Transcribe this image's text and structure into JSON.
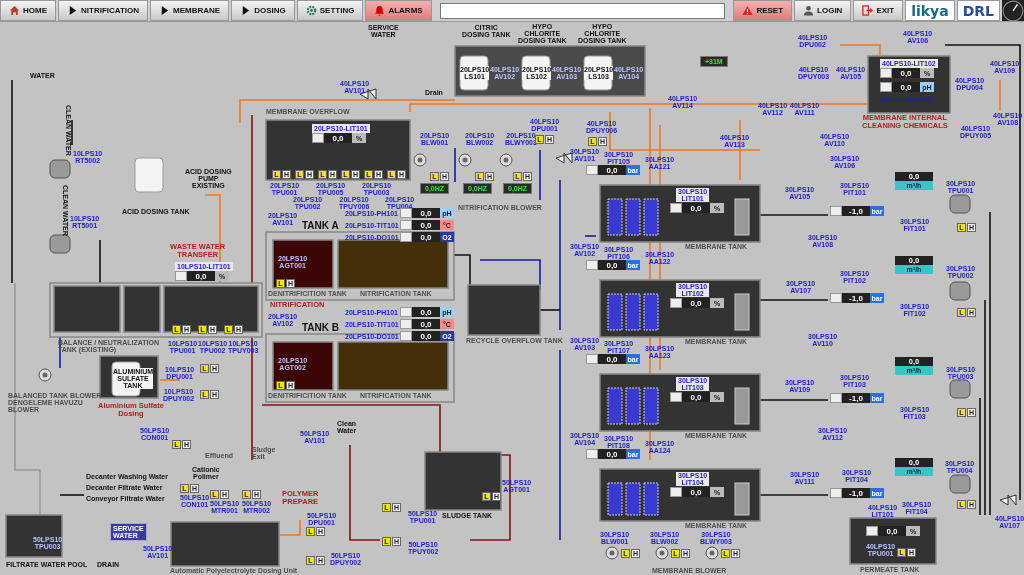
{
  "toolbar": {
    "buttons": [
      {
        "label": "HOME",
        "kind": "home"
      },
      {
        "label": "NITRIFICATION",
        "kind": "nav"
      },
      {
        "label": "MEMBRANE",
        "kind": "nav"
      },
      {
        "label": "DOSING",
        "kind": "nav"
      },
      {
        "label": "SETTING",
        "kind": "setting"
      },
      {
        "label": "ALARMS",
        "kind": "alarm"
      }
    ],
    "actions": [
      {
        "label": "RESET",
        "kind": "reset"
      },
      {
        "label": "LOGIN",
        "kind": "login"
      },
      {
        "label": "EXIT",
        "kind": "exit"
      }
    ],
    "logos": [
      "likya",
      "DRL"
    ]
  },
  "diagram": {
    "labels": [
      {
        "lines": [
          "SERVICE",
          "WATER"
        ],
        "kind": "black"
      },
      {
        "lines": [
          "40LPS10",
          "AV101"
        ],
        "kind": "tag"
      },
      {
        "lines": [
          "Drain"
        ],
        "kind": "black"
      },
      {
        "lines": [
          "CITRIC",
          "DOSING TANK"
        ],
        "kind": "black"
      },
      {
        "lines": [
          "HYPO",
          "CHLORITE",
          "DOSING TANK"
        ],
        "kind": "black"
      },
      {
        "lines": [
          "HYPO",
          "CHLORITE",
          "DOSING TANK"
        ],
        "kind": "black"
      },
      {
        "lines": [
          "20LPS10",
          "LS101"
        ],
        "kind": "tank"
      },
      {
        "lines": [
          "40LPS10",
          "AV102"
        ],
        "kind": "darktag"
      },
      {
        "lines": [
          "20LPS10",
          "LS102"
        ],
        "kind": "tank"
      },
      {
        "lines": [
          "40LPS10",
          "AV103"
        ],
        "kind": "darktag"
      },
      {
        "lines": [
          "20LPS10",
          "LS103"
        ],
        "kind": "tank"
      },
      {
        "lines": [
          "40LPS10",
          "AV104"
        ],
        "kind": "darktag"
      },
      {
        "lines": [
          "40LPS10",
          "DPU002"
        ],
        "kind": "tag"
      },
      {
        "lines": [
          "40LPS10",
          "DPUY003"
        ],
        "kind": "tag"
      },
      {
        "lines": [
          "40LPS10",
          "AV105"
        ],
        "kind": "tag"
      },
      {
        "lines": [
          "40LPS10",
          "AV106"
        ],
        "kind": "tag"
      },
      {
        "lines": [
          "MEMBRANE INTERNAL",
          "CLEANING CHEMICALS"
        ],
        "kind": "red"
      },
      {
        "lines": [
          "40LPS10",
          "DPU004"
        ],
        "kind": "tag"
      },
      {
        "lines": [
          "40LPS10",
          "AV109"
        ],
        "kind": "tag"
      },
      {
        "lines": [
          "40LPS10",
          "DPUY005"
        ],
        "kind": "tag"
      },
      {
        "lines": [
          "40LPS10",
          "AV108"
        ],
        "kind": "tag"
      },
      {
        "lines": [
          "40LPS10",
          "AV114"
        ],
        "kind": "tag"
      },
      {
        "lines": [
          "40LPS10",
          "DPU001"
        ],
        "kind": "tag"
      },
      {
        "lines": [
          "40LPS10",
          "DPUY006"
        ],
        "kind": "tag"
      },
      {
        "lines": [
          "30LPS10",
          "AV101"
        ],
        "kind": "tag"
      },
      {
        "lines": [
          "40LPS10",
          "AV112"
        ],
        "kind": "tag"
      },
      {
        "lines": [
          "40LPS10",
          "AV111"
        ],
        "kind": "tag"
      },
      {
        "lines": [
          "40LPS10",
          "AV113"
        ],
        "kind": "tag"
      },
      {
        "lines": [
          "40LPS10",
          "AV110"
        ],
        "kind": "tag"
      },
      {
        "lines": [
          "MEMBRANE OVERFLOW"
        ],
        "kind": "title"
      },
      {
        "lines": [
          "20LPS10",
          "TPU001"
        ],
        "kind": "tag"
      },
      {
        "lines": [
          "20LPS10",
          "TPU002"
        ],
        "kind": "tag"
      },
      {
        "lines": [
          "20LPS10",
          "TPU005"
        ],
        "kind": "tag"
      },
      {
        "lines": [
          "20LPS10",
          "TPUY006"
        ],
        "kind": "tag"
      },
      {
        "lines": [
          "20LPS10",
          "TPU003"
        ],
        "kind": "tag"
      },
      {
        "lines": [
          "20LPS10",
          "TPU004"
        ],
        "kind": "tag"
      },
      {
        "lines": [
          "20LPS10",
          "BLW001"
        ],
        "kind": "tag"
      },
      {
        "lines": [
          "20LPS10",
          "BLW002"
        ],
        "kind": "tag"
      },
      {
        "lines": [
          "20LPS10",
          "BLWY003"
        ],
        "kind": "tag"
      },
      {
        "lines": [
          "NITRIFICATION BLOWER"
        ],
        "kind": "title"
      },
      {
        "lines": [
          "20LPS10",
          "AV101"
        ],
        "kind": "tag"
      },
      {
        "lines": [
          "TANK A"
        ],
        "kind": "big"
      },
      {
        "lines": [
          "20LPS10",
          "AGT001"
        ],
        "kind": "darktag"
      },
      {
        "lines": [
          "DENITRIFICITION TANK"
        ],
        "kind": "title"
      },
      {
        "lines": [
          "NITRIFICATION TANK"
        ],
        "kind": "title"
      },
      {
        "lines": [
          "NITRIFICATION"
        ],
        "kind": "red"
      },
      {
        "lines": [
          "20LPS10",
          "AV102"
        ],
        "kind": "tag"
      },
      {
        "lines": [
          "TANK B"
        ],
        "kind": "big"
      },
      {
        "lines": [
          "20LPS10",
          "AGT002"
        ],
        "kind": "darktag"
      },
      {
        "lines": [
          "DENITRIFICITION TANK"
        ],
        "kind": "title"
      },
      {
        "lines": [
          "NITRIFICATION TANK"
        ],
        "kind": "title"
      },
      {
        "lines": [
          "RECYCLE OVERFLOW TANK"
        ],
        "kind": "title"
      },
      {
        "lines": [
          "WATER"
        ],
        "kind": "black"
      },
      {
        "lines": [
          "CLEAN WATER"
        ],
        "kind": "vertical"
      },
      {
        "lines": [
          "10LPS10",
          "RT5002"
        ],
        "kind": "tag"
      },
      {
        "lines": [
          "CLEAN WATER"
        ],
        "kind": "vertical"
      },
      {
        "lines": [
          "10LPS10",
          "RT5001"
        ],
        "kind": "tag"
      },
      {
        "lines": [
          "ACID DOSING TANK"
        ],
        "kind": "black"
      },
      {
        "lines": [
          "ACID DOSING",
          "PUMP",
          "EXISTING"
        ],
        "kind": "black"
      },
      {
        "lines": [
          "WASTE WATER",
          "TRANSFER"
        ],
        "kind": "red"
      },
      {
        "lines": [
          "BALANCE / NEUTRALIZATION",
          "TANK (EXISTING)"
        ],
        "kind": "title"
      },
      {
        "lines": [
          "10LPS10",
          "TPU001"
        ],
        "kind": "tag"
      },
      {
        "lines": [
          "10LPS10",
          "TPU002"
        ],
        "kind": "tag"
      },
      {
        "lines": [
          "10LPS10",
          "TPUY003"
        ],
        "kind": "tag"
      },
      {
        "lines": [
          "BALANCED TANK BLOWER",
          "DENGELEME HAVUZU",
          "BLOWER"
        ],
        "kind": "title"
      },
      {
        "lines": [
          "ALUMINIUM",
          "SULFATE",
          "TANK"
        ],
        "kind": "tank"
      },
      {
        "lines": [
          "10LPS10",
          "DPU001"
        ],
        "kind": "tag"
      },
      {
        "lines": [
          "10LPS10",
          "DPUY002"
        ],
        "kind": "tag"
      },
      {
        "lines": [
          "Aluminium Sulfate",
          "Dosing"
        ],
        "kind": "red"
      },
      {
        "lines": [
          "50LPS10",
          "CON001"
        ],
        "kind": "tag"
      },
      {
        "lines": [
          "Effluend"
        ],
        "kind": "title"
      },
      {
        "lines": [
          "Sludge",
          "Exit"
        ],
        "kind": "title"
      },
      {
        "lines": [
          "50LPS10",
          "AV101"
        ],
        "kind": "tag"
      },
      {
        "lines": [
          "Clean",
          "Water"
        ],
        "kind": "black"
      },
      {
        "lines": [
          "Decanter Washing Water"
        ],
        "kind": "black"
      },
      {
        "lines": [
          "Decanter Filtrate Water"
        ],
        "kind": "black"
      },
      {
        "lines": [
          "Conveyor Filtrate Water"
        ],
        "kind": "black"
      },
      {
        "lines": [
          "Cationic",
          "Polimer"
        ],
        "kind": "black"
      },
      {
        "lines": [
          "50LPS10",
          "CON101"
        ],
        "kind": "tag"
      },
      {
        "lines": [
          "50LPS10",
          "MTR001"
        ],
        "kind": "tag"
      },
      {
        "lines": [
          "50LPS10",
          "MTR002"
        ],
        "kind": "tag"
      },
      {
        "lines": [
          "SERVICE",
          "WATER"
        ],
        "kind": "badge"
      },
      {
        "lines": [
          "50LPS10",
          "AV101"
        ],
        "kind": "tag"
      },
      {
        "lines": [
          "50LPS10",
          "TPU003"
        ],
        "kind": "darktag"
      },
      {
        "lines": [
          "FILTRATE WATER POOL"
        ],
        "kind": "black"
      },
      {
        "lines": [
          "DRAIN"
        ],
        "kind": "black"
      },
      {
        "lines": [
          "Automatic Polyelectrolyte Dosing Unit"
        ],
        "kind": "title"
      },
      {
        "lines": [
          "POLYMER",
          "PREPARE"
        ],
        "kind": "red"
      },
      {
        "lines": [
          "50LPS10",
          "DPU001"
        ],
        "kind": "tag"
      },
      {
        "lines": [
          "50LPS10",
          "DPUY002"
        ],
        "kind": "tag"
      },
      {
        "lines": [
          "SLUDGE TANK"
        ],
        "kind": "black"
      },
      {
        "lines": [
          "50LPS10",
          "AGT001"
        ],
        "kind": "tag"
      },
      {
        "lines": [
          "50LPS10",
          "TPU001"
        ],
        "kind": "tag"
      },
      {
        "lines": [
          "50LPS10",
          "TPUY002"
        ],
        "kind": "tag"
      },
      {
        "lines": [
          "30LPS10",
          "AV102"
        ],
        "kind": "tag"
      },
      {
        "lines": [
          "30LPS10",
          "AV103"
        ],
        "kind": "tag"
      },
      {
        "lines": [
          "30LPS10",
          "AV104"
        ],
        "kind": "tag"
      },
      {
        "lines": [
          "30LPS10",
          "PIT105"
        ],
        "kind": "tag"
      },
      {
        "lines": [
          "30LPS10",
          "PIT106"
        ],
        "kind": "tag"
      },
      {
        "lines": [
          "30LPS10",
          "PIT107"
        ],
        "kind": "tag"
      },
      {
        "lines": [
          "30LPS10",
          "PIT108"
        ],
        "kind": "tag"
      },
      {
        "lines": [
          "30LPS10",
          "AA121"
        ],
        "kind": "tag"
      },
      {
        "lines": [
          "30LPS10",
          "AA122"
        ],
        "kind": "tag"
      },
      {
        "lines": [
          "30LPS10",
          "AA123"
        ],
        "kind": "tag"
      },
      {
        "lines": [
          "30LPS10",
          "AA124"
        ],
        "kind": "tag"
      },
      {
        "lines": [
          "30LPS10",
          "LIT101"
        ],
        "kind": "boxtag"
      },
      {
        "lines": [
          "MEMBRANE TANK"
        ],
        "kind": "title"
      },
      {
        "lines": [
          "30LPS10",
          "LIT102"
        ],
        "kind": "boxtag"
      },
      {
        "lines": [
          "MEMBRANE TANK"
        ],
        "kind": "title"
      },
      {
        "lines": [
          "30LPS10",
          "LIT103"
        ],
        "kind": "boxtag"
      },
      {
        "lines": [
          "MEMBRANE TANK"
        ],
        "kind": "title"
      },
      {
        "lines": [
          "30LPS10",
          "LIT104"
        ],
        "kind": "boxtag"
      },
      {
        "lines": [
          "MEMBRANE TANK"
        ],
        "kind": "title"
      },
      {
        "lines": [
          "30LPS10",
          "AV106"
        ],
        "kind": "tag"
      },
      {
        "lines": [
          "30LPS10",
          "AV105"
        ],
        "kind": "tag"
      },
      {
        "lines": [
          "30LPS10",
          "PIT101"
        ],
        "kind": "tag"
      },
      {
        "lines": [
          "30LPS10",
          "FIT101"
        ],
        "kind": "tag"
      },
      {
        "lines": [
          "30LPS10",
          "TPU001"
        ],
        "kind": "tag"
      },
      {
        "lines": [
          "30LPS10",
          "AV108"
        ],
        "kind": "tag"
      },
      {
        "lines": [
          "30LPS10",
          "AV107"
        ],
        "kind": "tag"
      },
      {
        "lines": [
          "30LPS10",
          "PIT102"
        ],
        "kind": "tag"
      },
      {
        "lines": [
          "30LPS10",
          "FIT102"
        ],
        "kind": "tag"
      },
      {
        "lines": [
          "30LPS10",
          "TPU002"
        ],
        "kind": "tag"
      },
      {
        "lines": [
          "30LPS10",
          "AV110"
        ],
        "kind": "tag"
      },
      {
        "lines": [
          "30LPS10",
          "AV109"
        ],
        "kind": "tag"
      },
      {
        "lines": [
          "30LPS10",
          "PIT103"
        ],
        "kind": "tag"
      },
      {
        "lines": [
          "30LPS10",
          "FIT103"
        ],
        "kind": "tag"
      },
      {
        "lines": [
          "30LPS10",
          "TPU003"
        ],
        "kind": "tag"
      },
      {
        "lines": [
          "30LPS10",
          "AV112"
        ],
        "kind": "tag"
      },
      {
        "lines": [
          "30LPS10",
          "AV111"
        ],
        "kind": "tag"
      },
      {
        "lines": [
          "30LPS10",
          "PIT104"
        ],
        "kind": "tag"
      },
      {
        "lines": [
          "30LPS10",
          "FIT104"
        ],
        "kind": "tag"
      },
      {
        "lines": [
          "30LPS10",
          "TPU004"
        ],
        "kind": "tag"
      },
      {
        "lines": [
          "MEMBRANE BLOWER"
        ],
        "kind": "title"
      },
      {
        "lines": [
          "30LPS10",
          "BLW001"
        ],
        "kind": "tag"
      },
      {
        "lines": [
          "30LPS10",
          "BLW002"
        ],
        "kind": "tag"
      },
      {
        "lines": [
          "30LPS10",
          "BLWY003"
        ],
        "kind": "tag"
      },
      {
        "lines": [
          "40LPS10",
          "LIT101"
        ],
        "kind": "tag"
      },
      {
        "lines": [
          "40LPS10",
          "TPU001"
        ],
        "kind": "darktag"
      },
      {
        "lines": [
          "PERMEATE TANK"
        ],
        "kind": "title"
      },
      {
        "lines": [
          "40LPS10",
          "AV107"
        ],
        "kind": "tag"
      },
      {
        "lines": [
          "40LPS10-PH101"
        ],
        "kind": "tag"
      },
      {
        "lines": [
          "20LPS10-PH101"
        ],
        "kind": "tag"
      },
      {
        "lines": [
          "20LPS10-TIT101"
        ],
        "kind": "tag"
      },
      {
        "lines": [
          "20LPS10-DO101"
        ],
        "kind": "tag"
      },
      {
        "lines": [
          "20LPS10-PH101"
        ],
        "kind": "tag"
      },
      {
        "lines": [
          "20LPS10-TIT101"
        ],
        "kind": "tag"
      },
      {
        "lines": [
          "20LPS10-DO101"
        ],
        "kind": "tag"
      }
    ],
    "readouts": [
      {
        "tag": "40LPS10-LIT102",
        "value": "0,0",
        "unit": "%",
        "kind": "pct"
      },
      {
        "value": "0,0",
        "unit": "pH",
        "kind": "ph"
      },
      {
        "tag": "20LPS10-LIT101",
        "value": "0,0",
        "unit": "%",
        "kind": "pct"
      },
      {
        "value": "0,0",
        "unit": "pH",
        "kind": "ph"
      },
      {
        "value": "0,0",
        "unit": "°C",
        "kind": "temp"
      },
      {
        "value": "0,0",
        "unit": "O2",
        "kind": "o2"
      },
      {
        "value": "0,0",
        "unit": "pH",
        "kind": "ph"
      },
      {
        "value": "0,0",
        "unit": "°C",
        "kind": "temp"
      },
      {
        "value": "0,0",
        "unit": "O2",
        "kind": "o2"
      },
      {
        "tag": "10LPS10-LIT101",
        "value": "0,0",
        "unit": "%",
        "kind": "pct"
      },
      {
        "value": "0,0",
        "unit": "%",
        "kind": "pct"
      },
      {
        "value": "0,0",
        "unit": "%",
        "kind": "pct"
      },
      {
        "value": "0,0",
        "unit": "%",
        "kind": "pct"
      },
      {
        "value": "0,0",
        "unit": "%",
        "kind": "pct"
      },
      {
        "value": "0,0",
        "unit": "bar",
        "kind": "bar"
      },
      {
        "value": "0,0",
        "unit": "bar",
        "kind": "bar"
      },
      {
        "value": "0,0",
        "unit": "bar",
        "kind": "bar"
      },
      {
        "value": "0,0",
        "unit": "bar",
        "kind": "bar"
      },
      {
        "value": "-1,0",
        "unit": "bar",
        "kind": "bar"
      },
      {
        "value": "-1,0",
        "unit": "bar",
        "kind": "bar"
      },
      {
        "value": "-1,0",
        "unit": "bar",
        "kind": "bar"
      },
      {
        "value": "-1,0",
        "unit": "bar",
        "kind": "bar"
      },
      {
        "value": "0,0",
        "unit": "m³/h",
        "kind": "flow"
      },
      {
        "value": "0,0",
        "unit": "m³/h",
        "kind": "flow"
      },
      {
        "value": "0,0",
        "unit": "m³/h",
        "kind": "flow"
      },
      {
        "value": "0,0",
        "unit": "m³/h",
        "kind": "flow"
      },
      {
        "value": "0,0",
        "unit": "%",
        "kind": "pct"
      },
      {
        "value": "0,0HZ",
        "kind": "display"
      },
      {
        "value": "0,0HZ",
        "kind": "display"
      },
      {
        "value": "0,0HZ",
        "kind": "display"
      },
      {
        "value": "+31M",
        "kind": "display"
      }
    ],
    "indicators": [
      {
        "low": "L",
        "high": "H",
        "low_on": true
      },
      {
        "low": "L",
        "high": "H",
        "low_on": true
      },
      {
        "low": "L",
        "high": "H",
        "low_on": true
      },
      {
        "low": "L",
        "high": "H",
        "low_on": true
      },
      {
        "low": "L",
        "high": "H",
        "low_on": true
      },
      {
        "low": "L",
        "high": "H",
        "low_on": true
      },
      {
        "low": "L",
        "high": "H",
        "low_on": true
      },
      {
        "low": "L",
        "high": "H",
        "low_on": true
      },
      {
        "low": "L",
        "high": "H",
        "low_on": true
      },
      {
        "low": "L",
        "high": "H",
        "low_on": true
      },
      {
        "low": "L",
        "high": "H",
        "low_on": true
      },
      {
        "low": "L",
        "high": "H",
        "low_on": true
      },
      {
        "low": "L",
        "high": "H",
        "low_on": true
      },
      {
        "low": "L",
        "high": "H",
        "low_on": true
      },
      {
        "low": "L",
        "high": "H",
        "low_on": true
      },
      {
        "low": "L",
        "high": "H",
        "low_on": true
      },
      {
        "low": "L",
        "high": "H",
        "low_on": true
      },
      {
        "low": "L",
        "high": "H",
        "low_on": true
      },
      {
        "low": "L",
        "high": "H",
        "low_on": true
      },
      {
        "low": "L",
        "high": "H",
        "low_on": true
      },
      {
        "low": "L",
        "high": "H",
        "low_on": true
      },
      {
        "low": "L",
        "high": "H",
        "low_on": true
      },
      {
        "low": "L",
        "high": "H",
        "low_on": true
      },
      {
        "low": "L",
        "high": "H",
        "low_on": true
      },
      {
        "low": "L",
        "high": "H",
        "low_on": true
      },
      {
        "low": "L",
        "high": "H",
        "low_on": true
      },
      {
        "low": "L",
        "high": "H",
        "low_on": true
      },
      {
        "low": "L",
        "high": "H",
        "low_on": true
      },
      {
        "low": "L",
        "high": "H",
        "low_on": true
      },
      {
        "low": "L",
        "high": "H",
        "low_on": true
      },
      {
        "low": "L",
        "high": "H",
        "low_on": true
      },
      {
        "low": "L",
        "high": "H",
        "low_on": true
      },
      {
        "low": "L",
        "high": "H",
        "low_on": true
      },
      {
        "low": "L",
        "high": "H",
        "low_on": true
      },
      {
        "low": "L",
        "high": "H",
        "low_on": true
      }
    ]
  }
}
